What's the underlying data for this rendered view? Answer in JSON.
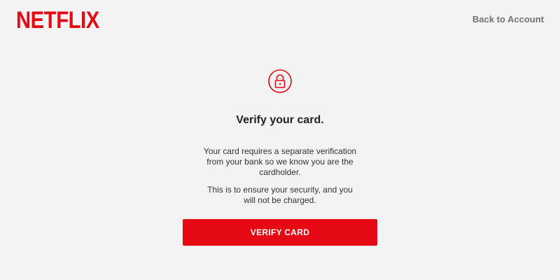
{
  "header": {
    "logo_text": "NETFLIX",
    "back_link_label": "Back to Account"
  },
  "main": {
    "icon": "lock-icon",
    "title": "Verify your card.",
    "message_1": "Your card requires a separate verification from your bank so we know you are the cardholder.",
    "message_2": "This is to ensure your security, and you will not be charged.",
    "verify_button_label": "VERIFY CARD"
  },
  "colors": {
    "brand_red": "#e50914",
    "background": "#f3f3f3",
    "link_gray": "#737373"
  }
}
